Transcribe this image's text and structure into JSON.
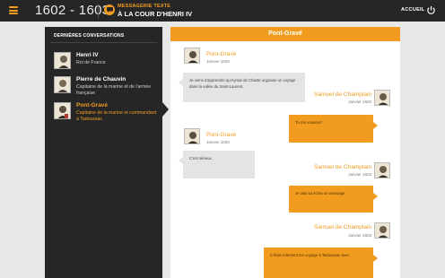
{
  "topbar": {
    "years": "1602 - 1603",
    "app_sub": "MESSAGERIE TEXTE",
    "app_title": "À LA COUR D'HENRI IV",
    "home_label": "ACCUEIL"
  },
  "sidebar": {
    "heading": "DERNIÈRES CONVERSATIONS",
    "contacts": [
      {
        "name": "Henri IV",
        "role": "Roi de France"
      },
      {
        "name": "Pierre de Chauvin",
        "role": "Capitaine de la marine et de l'armée française"
      },
      {
        "name": "Pont-Gravé",
        "role": "Capitaine de la marine et commandant à Tadoussac"
      }
    ]
  },
  "chat": {
    "title": "Pont-Gravé",
    "messages": [
      {
        "sender": "Pont-Gravé",
        "date": "Janvier 1603",
        "text": "Je viens d'apprendre qu'Aymar de Chaste organise un voyage dans la vallée du Saint-Laurent."
      },
      {
        "sender": "Samuel de Champlain",
        "date": "Janvier 1603",
        "text": "Tu me vouvois?"
      },
      {
        "sender": "Pont-Gravé",
        "date": "Janvier 1603",
        "text": "C'est sérieux."
      },
      {
        "sender": "Samuel de Champlain",
        "date": "Janvier 1603",
        "text": "Je vais lui écrire un message."
      },
      {
        "sender": "Samuel de Champlain",
        "date": "Janvier 1603",
        "text": "C'était comment ton voyage à Tadoussac avec"
      }
    ]
  },
  "colors": {
    "accent": "#f29c1f",
    "dark": "#262626"
  },
  "icons": {
    "menu": "hamburger-icon",
    "app": "chat-bubble-icon",
    "home": "power-icon"
  }
}
